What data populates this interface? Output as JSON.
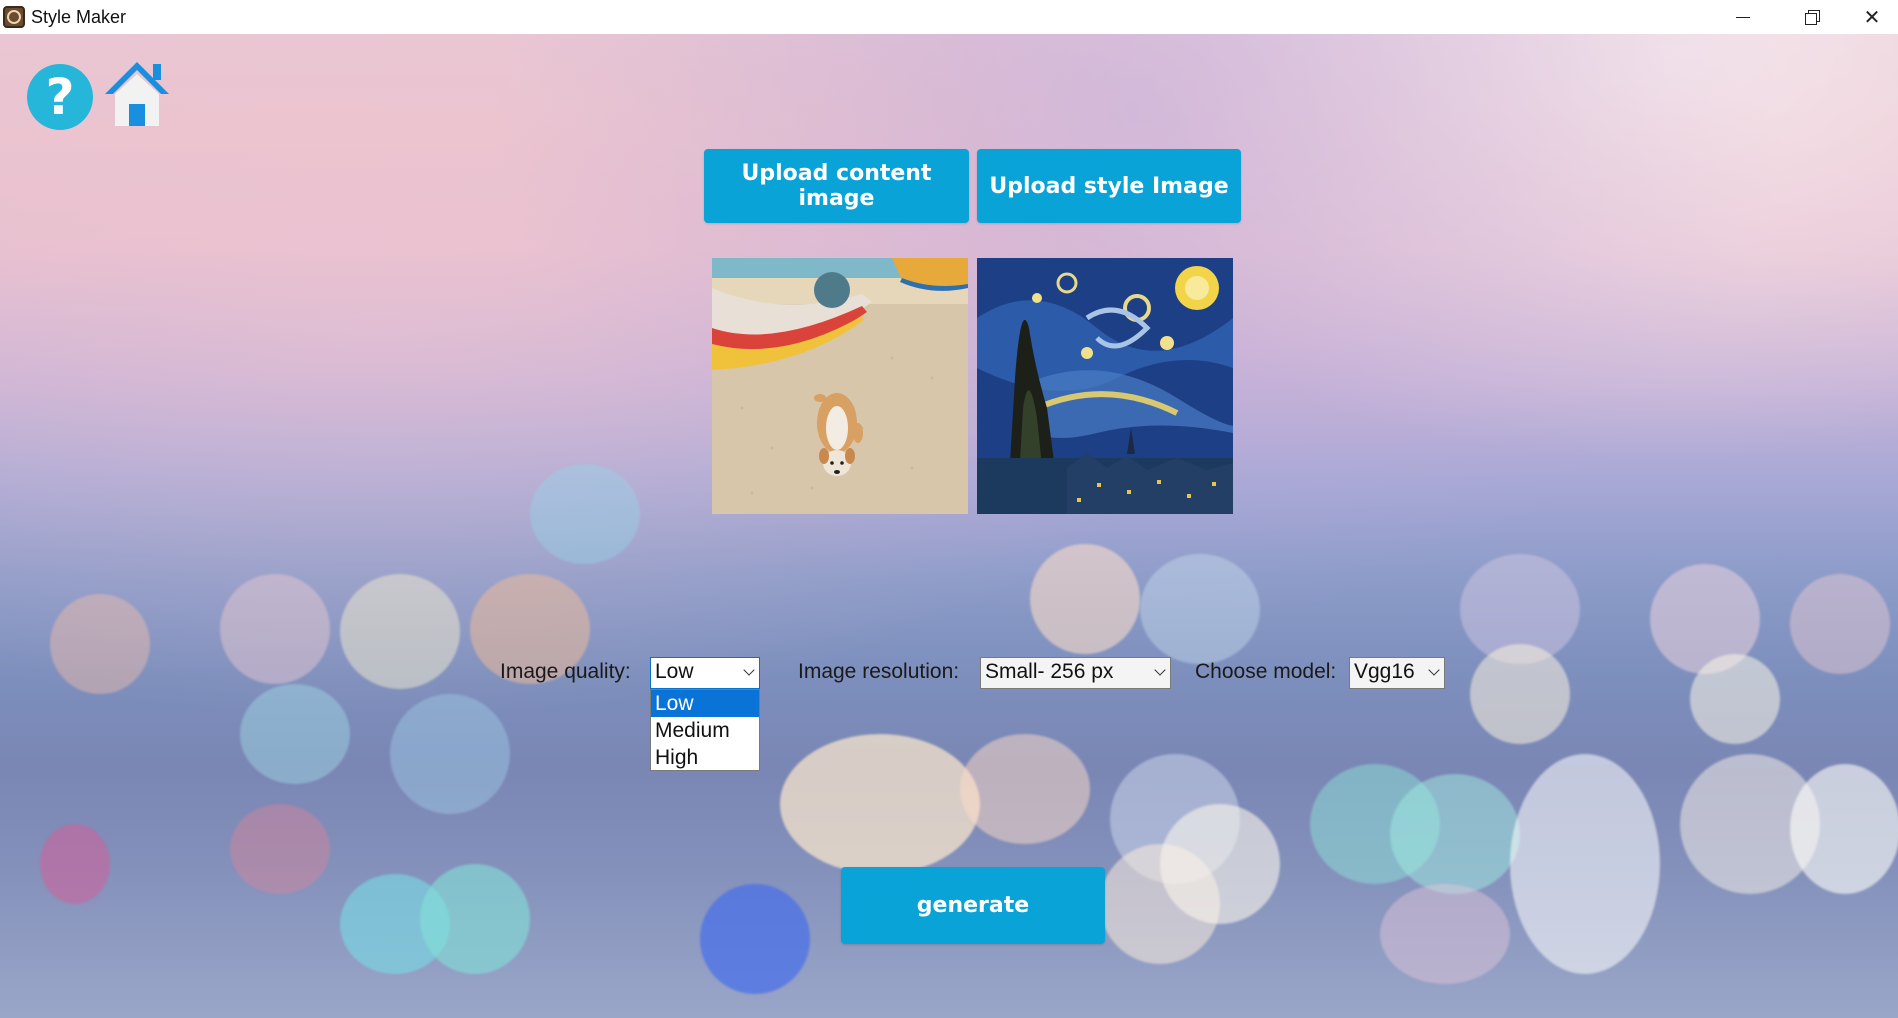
{
  "window": {
    "title": "Style Maker"
  },
  "toolbar": {
    "help_icon": "help-icon",
    "home_icon": "home-icon"
  },
  "buttons": {
    "upload_content": "Upload content image",
    "upload_style": "Upload style Image",
    "generate": "generate"
  },
  "previews": {
    "content_image": "beach-dog-boat-photo",
    "style_image": "starry-night-painting"
  },
  "controls": {
    "quality": {
      "label": "Image quality:",
      "value": "Low",
      "options": [
        "Low",
        "Medium",
        "High"
      ],
      "selected_index": 0,
      "expanded": true
    },
    "resolution": {
      "label": "Image resolution:",
      "value": "Small- 256 px"
    },
    "model": {
      "label": "Choose model:",
      "value": "Vgg16"
    }
  },
  "colors": {
    "accent": "#0aa3d7",
    "help_icon": "#25b6d9",
    "home_icon": "#1a8fe0",
    "selection": "#0a73d7"
  }
}
